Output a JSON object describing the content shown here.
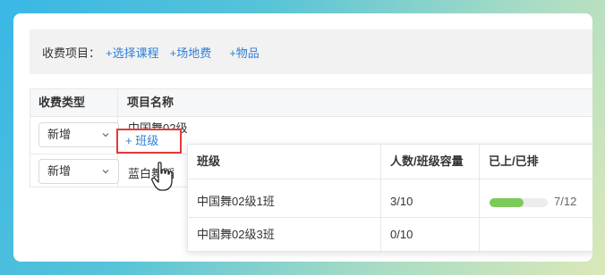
{
  "charge_items": {
    "label": "收费项目：",
    "links": [
      "+选择课程",
      "+场地费",
      "+物品"
    ]
  },
  "table": {
    "headers": [
      "收费类型",
      "项目名称"
    ],
    "rows": [
      {
        "type": "新增",
        "name": "中国舞02级"
      },
      {
        "type": "新增",
        "name": "蓝白舞蹈"
      }
    ],
    "add_class_label": "+ 班级"
  },
  "popover": {
    "headers": [
      "班级",
      "人数/班级容量",
      "已上/已排"
    ],
    "rows": [
      {
        "class": "中国舞02级1班",
        "capacity": "3/10",
        "progress_text": "7/12",
        "progress": 0.58
      },
      {
        "class": "中国舞02级3班",
        "capacity": "0/10",
        "progress_text": "",
        "progress": null
      }
    ]
  },
  "colors": {
    "link": "#2f7fd6",
    "highlight_border": "#e33a3a",
    "progress_fill": "#7ccb5a"
  }
}
